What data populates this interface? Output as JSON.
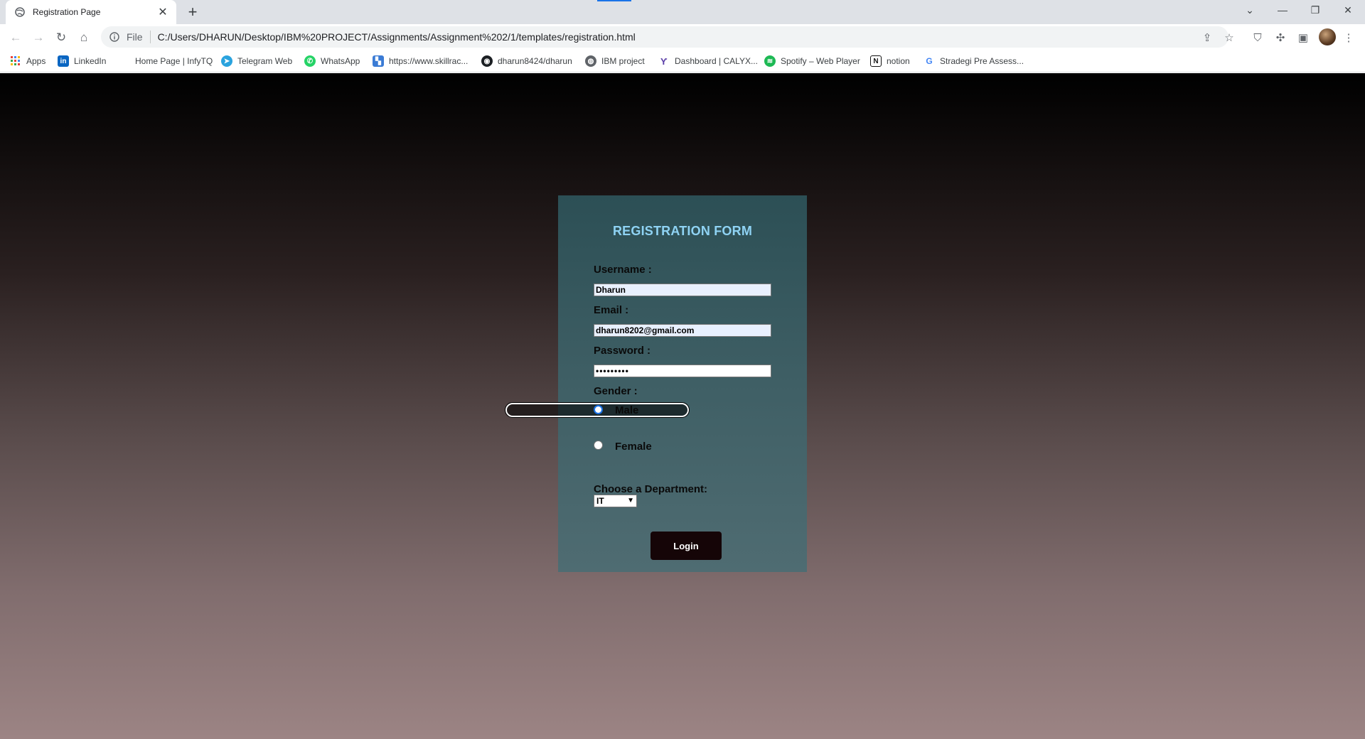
{
  "browser": {
    "tab": {
      "title": "Registration Page"
    },
    "omnibox": {
      "scheme_label": "File",
      "url": "C:/Users/DHARUN/Desktop/IBM%20PROJECT/Assignments/Assignment%202/1/templates/registration.html"
    },
    "bookmarks": [
      {
        "label": "Apps",
        "icon": "apps-grid-icon",
        "color": "#e8453c"
      },
      {
        "label": "LinkedIn",
        "icon": "linkedin-icon",
        "color": "#0a66c2"
      },
      {
        "label": "Home Page | InfyTQ",
        "icon": "blank-icon",
        "color": "#ffffff"
      },
      {
        "label": "Telegram Web",
        "icon": "telegram-icon",
        "color": "#2aa3de"
      },
      {
        "label": "WhatsApp",
        "icon": "whatsapp-icon",
        "color": "#25d366"
      },
      {
        "label": "https://www.skillrac...",
        "icon": "skillrack-icon",
        "color": "#3a7bd5"
      },
      {
        "label": "dharun8424/dharun",
        "icon": "github-icon",
        "color": "#1b1f23"
      },
      {
        "label": "IBM project",
        "icon": "globe-icon",
        "color": "#5f6368"
      },
      {
        "label": "Dashboard | CALYX...",
        "icon": "calyx-icon",
        "color": "#5b3fa8"
      },
      {
        "label": "Spotify – Web Player",
        "icon": "spotify-icon",
        "color": "#1db954"
      },
      {
        "label": "notion",
        "icon": "notion-icon",
        "color": "#111111"
      },
      {
        "label": "Stradegi Pre Assess...",
        "icon": "google-icon",
        "color": "#4285f4"
      }
    ]
  },
  "form": {
    "title": "REGISTRATION FORM",
    "username_label": "Username :",
    "username_value": "Dharun",
    "email_label": "Email :",
    "email_value": "dharun8202@gmail.com",
    "password_label": "Password :",
    "password_mask": "•••••••••",
    "gender_label": "Gender :",
    "gender_options": [
      {
        "label": "Male",
        "checked": true
      },
      {
        "label": "Female",
        "checked": false
      }
    ],
    "department_label": "Choose a Department:",
    "department_value": "IT",
    "login_label": "Login"
  },
  "colors": {
    "title_accent": "#8fd3f4",
    "card_bg": "#3f5f65",
    "button_bg": "#150507"
  }
}
